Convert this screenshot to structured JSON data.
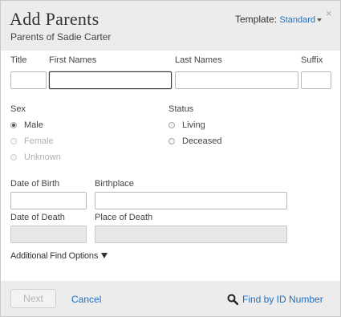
{
  "header": {
    "title": "Add Parents",
    "subtitle": "Parents of Sadie Carter",
    "template_label": "Template:",
    "template_value": "Standard",
    "close_glyph": "×"
  },
  "name_section": {
    "title_label": "Title",
    "first_names_label": "First Names",
    "last_names_label": "Last Names",
    "suffix_label": "Suffix",
    "title_value": "",
    "first_names_value": "",
    "last_names_value": "",
    "suffix_value": ""
  },
  "sex": {
    "label": "Sex",
    "options": [
      "Male",
      "Female",
      "Unknown"
    ],
    "selected": "Male"
  },
  "status": {
    "label": "Status",
    "options": [
      "Living",
      "Deceased"
    ],
    "selected": ""
  },
  "dates": {
    "dob_label": "Date of Birth",
    "birthplace_label": "Birthplace",
    "dod_label": "Date of Death",
    "pod_label": "Place of Death",
    "dob_value": "",
    "birthplace_value": "",
    "dod_value": "",
    "pod_value": ""
  },
  "advanced_link": "Additional Find Options",
  "footer": {
    "next_label": "Next",
    "cancel_label": "Cancel",
    "find_label": "Find by ID Number"
  },
  "colors": {
    "link": "#1f6fbf",
    "header_bg": "#ececec"
  }
}
